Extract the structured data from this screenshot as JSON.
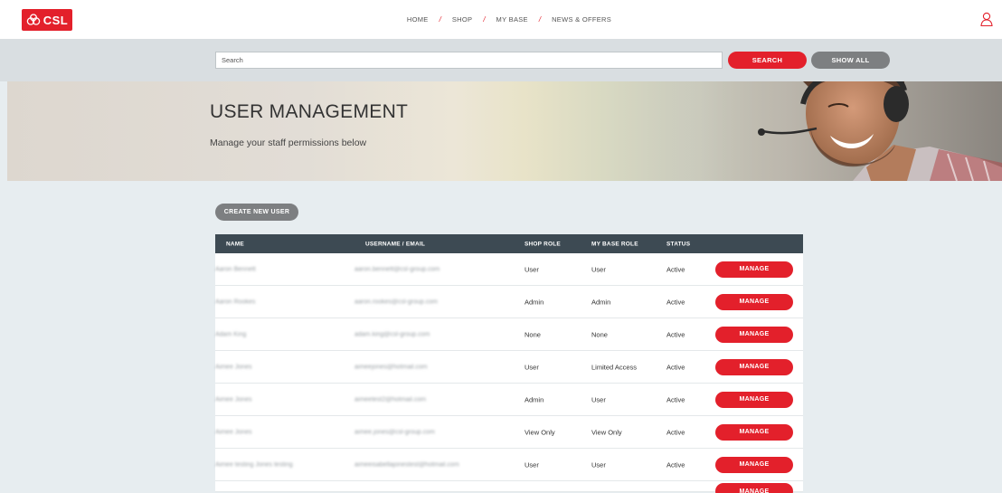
{
  "brand": {
    "logo_text": "CSL",
    "accent_color": "#e3202b"
  },
  "nav": {
    "items": [
      {
        "label": "HOME"
      },
      {
        "label": "SHOP"
      },
      {
        "label": "MY BASE"
      },
      {
        "label": "NEWS & OFFERS"
      }
    ],
    "separator": "/",
    "user_icon": "user-icon"
  },
  "search": {
    "placeholder": "Search",
    "value": "",
    "search_label": "SEARCH",
    "show_all_label": "SHOW ALL"
  },
  "hero": {
    "title": "USER MANAGEMENT",
    "subtitle": "Manage your staff permissions below"
  },
  "actions": {
    "create_label": "CREATE NEW USER"
  },
  "table": {
    "headers": {
      "name": "NAME",
      "username": "USERNAME / EMAIL",
      "shop_role": "SHOP ROLE",
      "mybase_role": "MY BASE ROLE",
      "status": "STATUS"
    },
    "manage_label": "MANAGE",
    "rows": [
      {
        "name": "Aaron Bennett",
        "username": "aaron.bennett@csl-group.com",
        "shop_role": "User",
        "mybase_role": "User",
        "status": "Active"
      },
      {
        "name": "Aaron Rookes",
        "username": "aaron.rookes@csl-group.com",
        "shop_role": "Admin",
        "mybase_role": "Admin",
        "status": "Active"
      },
      {
        "name": "Adam King",
        "username": "adam.king@csl-group.com",
        "shop_role": "None",
        "mybase_role": "None",
        "status": "Active"
      },
      {
        "name": "Aimee Jones",
        "username": "aimeejones@hotmail.com",
        "shop_role": "User",
        "mybase_role": "Limited Access",
        "status": "Active"
      },
      {
        "name": "Aimee Jones",
        "username": "aimeetest2@hotmail.com",
        "shop_role": "Admin",
        "mybase_role": "User",
        "status": "Active"
      },
      {
        "name": "Aimee Jones",
        "username": "aimee.jones@csl-group.com",
        "shop_role": "View Only",
        "mybase_role": "View Only",
        "status": "Active"
      },
      {
        "name": "Aimee testing Jones testing",
        "username": "aimeeisabellajonestest@hotmail.com",
        "shop_role": "User",
        "mybase_role": "User",
        "status": "Active"
      }
    ]
  }
}
